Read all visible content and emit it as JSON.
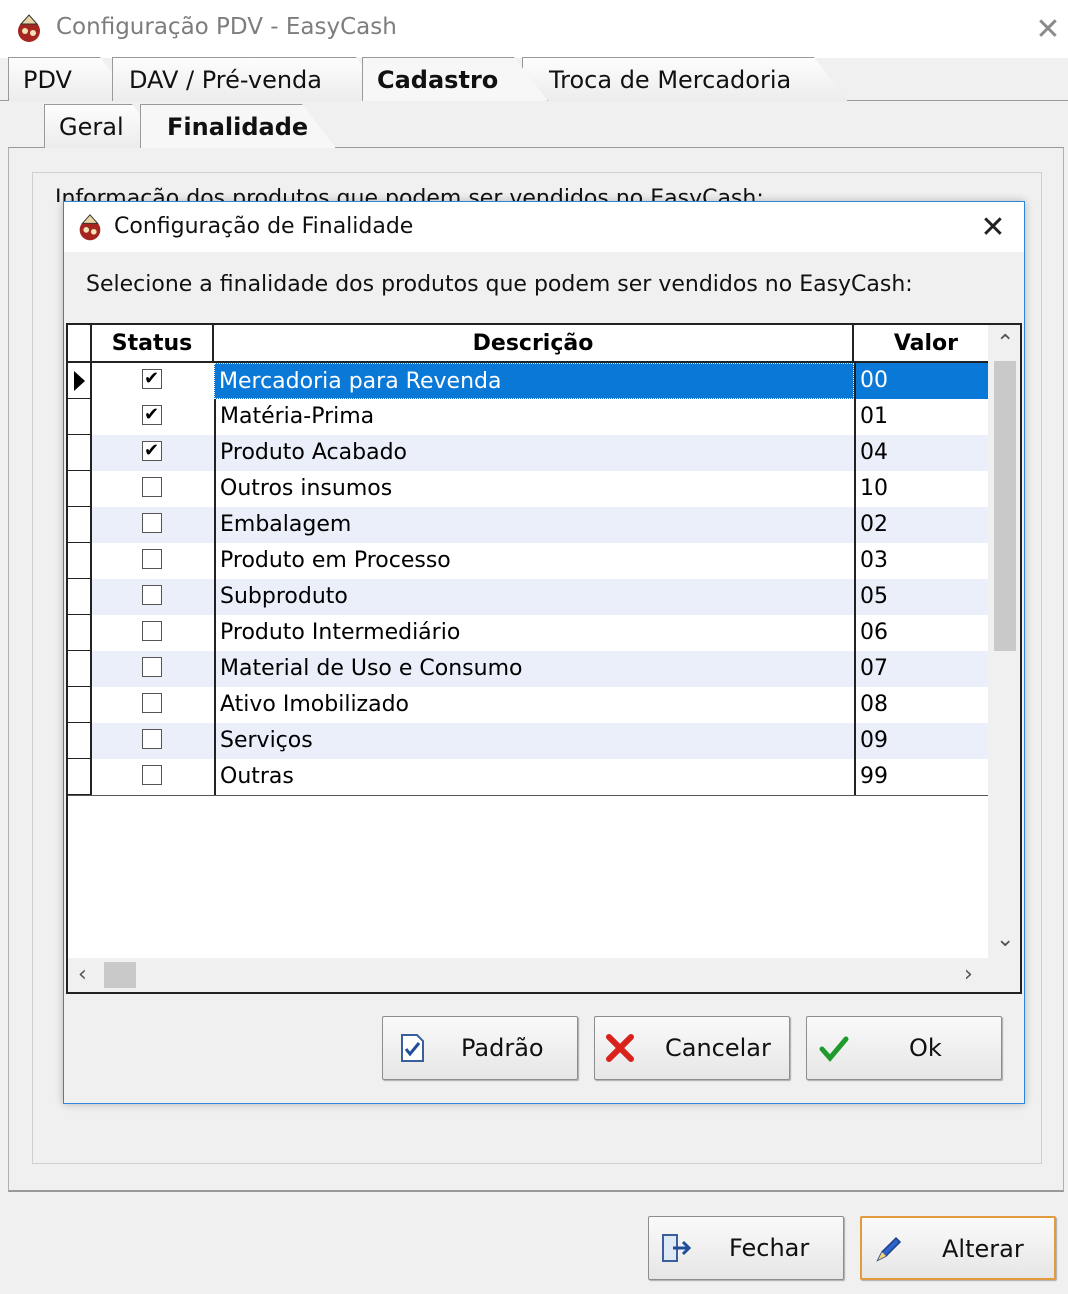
{
  "window": {
    "title": "Configuração PDV - EasyCash"
  },
  "main_tabs": [
    {
      "label": "PDV"
    },
    {
      "label": "DAV / Pré-venda"
    },
    {
      "label": "Cadastro"
    },
    {
      "label": "Troca de Mercadoria"
    }
  ],
  "sub_tabs": [
    {
      "label": "Geral"
    },
    {
      "label": "Finalidade"
    }
  ],
  "background_text": "Informação dos produtos que podem ser vendidos no EasyCash:",
  "dialog": {
    "title": "Configuração de Finalidade",
    "instruction": "Selecione a finalidade dos produtos que podem ser vendidos no EasyCash:",
    "columns": {
      "status": "Status",
      "descricao": "Descrição",
      "valor": "Valor"
    },
    "rows": [
      {
        "checked": true,
        "descricao": "Mercadoria para Revenda",
        "valor": "00",
        "selected": true
      },
      {
        "checked": true,
        "descricao": "Matéria-Prima",
        "valor": "01"
      },
      {
        "checked": true,
        "descricao": "Produto Acabado",
        "valor": "04"
      },
      {
        "checked": false,
        "descricao": "Outros insumos",
        "valor": "10"
      },
      {
        "checked": false,
        "descricao": "Embalagem",
        "valor": "02"
      },
      {
        "checked": false,
        "descricao": "Produto em Processo",
        "valor": "03"
      },
      {
        "checked": false,
        "descricao": "Subproduto",
        "valor": "05"
      },
      {
        "checked": false,
        "descricao": "Produto Intermediário",
        "valor": "06"
      },
      {
        "checked": false,
        "descricao": "Material de Uso e Consumo",
        "valor": "07"
      },
      {
        "checked": false,
        "descricao": "Ativo Imobilizado",
        "valor": "08"
      },
      {
        "checked": false,
        "descricao": "Serviços",
        "valor": "09"
      },
      {
        "checked": false,
        "descricao": "Outras",
        "valor": "99"
      }
    ],
    "buttons": {
      "padrao": "Padrão",
      "cancelar": "Cancelar",
      "ok": "Ok"
    }
  },
  "footer_buttons": {
    "fechar": "Fechar",
    "alterar": "Alterar"
  },
  "colors": {
    "selection": "#0a78d7",
    "alt_row": "#ebeff9",
    "dialog_border": "#2b87d8",
    "focus_border": "#e29a3c"
  }
}
